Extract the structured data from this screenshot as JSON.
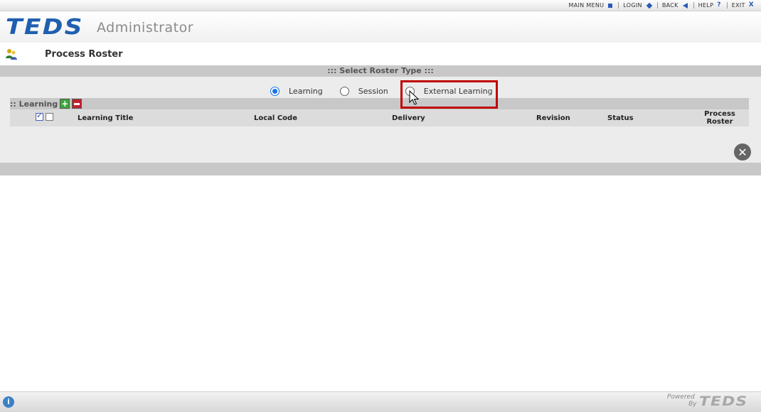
{
  "topnav": {
    "items": [
      {
        "label": "MAIN MENU",
        "icon": "square-icon"
      },
      {
        "label": "LOGIN",
        "icon": "diamond-icon"
      },
      {
        "label": "BACK",
        "icon": "back-arrow-icon"
      },
      {
        "label": "HELP",
        "icon": "?"
      },
      {
        "label": "EXIT",
        "icon": "X"
      }
    ]
  },
  "header": {
    "logo_text": "TEDS",
    "subtitle": "Administrator"
  },
  "page": {
    "title": "Process Roster"
  },
  "roster_type": {
    "heading": "::: Select Roster Type :::",
    "options": [
      {
        "label": "Learning",
        "selected": true
      },
      {
        "label": "Session",
        "selected": false
      },
      {
        "label": "External Learning",
        "selected": false
      }
    ]
  },
  "learning_section": {
    "heading": ":: Learning",
    "add_symbol": "+",
    "columns": [
      "Learning Title",
      "Local Code",
      "Delivery",
      "Revision",
      "Status"
    ],
    "process_roster_col": {
      "line1": "Process",
      "line2": "Roster"
    },
    "rows": []
  },
  "close_symbol": "✕",
  "footer": {
    "info_symbol": "i",
    "powered": "Powered",
    "by": "By",
    "logo_text": "TEDS"
  },
  "colors": {
    "brand_blue": "#1f5fb0",
    "highlight_red": "#c00000",
    "band_gray": "#c8c8c8",
    "panel_gray": "#ececec"
  }
}
